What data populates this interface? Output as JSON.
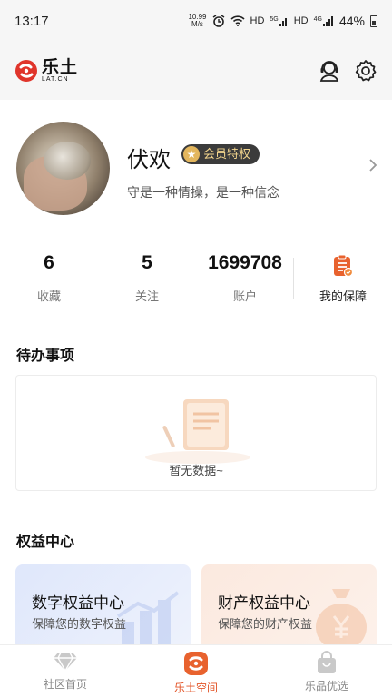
{
  "status_bar": {
    "time": "13:17",
    "net_speed_value": "10.99",
    "net_speed_unit": "M/s",
    "hd1": "HD",
    "signal1": "5G",
    "hd2": "HD",
    "signal2": "4G",
    "battery": "44%"
  },
  "header": {
    "logo_cn": "乐土",
    "logo_en": "LAT.CN",
    "icons": [
      "customer-service-icon",
      "settings-gear-icon"
    ]
  },
  "profile": {
    "username": "伏欢",
    "vip_label": "会员特权",
    "motto": "守是一种情操，是一种信念"
  },
  "stats": [
    {
      "value": "6",
      "label": "收藏"
    },
    {
      "value": "5",
      "label": "关注"
    },
    {
      "value": "1699708",
      "label": "账户"
    }
  ],
  "guarantee": {
    "label": "我的保障",
    "icon": "clipboard-check-icon"
  },
  "todo": {
    "title": "待办事项",
    "empty_text": "暂无数据~"
  },
  "rights": {
    "title": "权益中心",
    "cards": [
      {
        "title": "数字权益中心",
        "subtitle": "保障您的数字权益"
      },
      {
        "title": "财产权益中心",
        "subtitle": "保障您的财产权益"
      }
    ]
  },
  "bottom_nav": [
    {
      "label": "社区首页",
      "icon": "diamond-icon",
      "active": false
    },
    {
      "label": "乐土空间",
      "icon": "letu-logo-icon",
      "active": true
    },
    {
      "label": "乐品优选",
      "icon": "shopping-bag-icon",
      "active": false
    }
  ],
  "colors": {
    "accent": "#e3562a",
    "vip_badge_bg": "#3b3b3b",
    "vip_text": "#f3d58d"
  }
}
